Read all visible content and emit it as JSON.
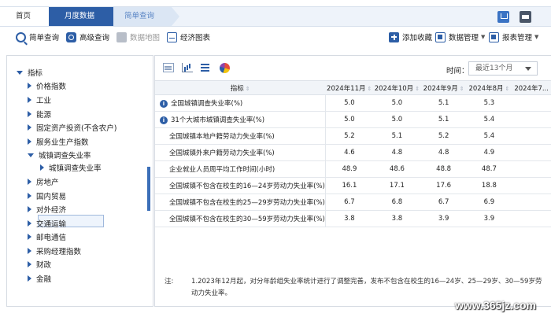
{
  "breadcrumb": {
    "home": "首页",
    "current": "月度数据",
    "next": "简单查询"
  },
  "toolbar": {
    "simple_query": "简单查询",
    "advanced_query": "高级查询",
    "data_map": "数据地图",
    "econ_chart": "经济图表",
    "add_favorite": "添加收藏",
    "data_manage": "数据管理",
    "report_manage": "报表管理"
  },
  "tree": {
    "root": "指标",
    "items": [
      "价格指数",
      "工业",
      "能源",
      "固定资产投资(不含农户)",
      "服务业生产指数",
      "城镇调查失业率",
      "城镇调查失业率",
      "房地产",
      "国内贸易",
      "对外经济",
      "交通运输",
      "邮电通信",
      "采购经理指数",
      "财政",
      "金融"
    ]
  },
  "controls": {
    "time_label": "时间：",
    "time_value": "最近13个月"
  },
  "table": {
    "header_indicator": "指标",
    "columns": [
      "2024年11月",
      "2024年10月",
      "2024年9月",
      "2024年8月",
      "2024年7..."
    ],
    "rows": [
      {
        "name": "全国城镇调查失业率(%)",
        "info": true,
        "values": [
          "5.0",
          "5.0",
          "5.1",
          "5.3"
        ]
      },
      {
        "name": "31个大城市城镇调查失业率(%)",
        "info": true,
        "values": [
          "5.0",
          "5.0",
          "5.1",
          "5.4"
        ]
      },
      {
        "name": "全国城镇本地户籍劳动力失业率(%)",
        "info": false,
        "values": [
          "5.2",
          "5.1",
          "5.2",
          "5.4"
        ]
      },
      {
        "name": "全国城镇外来户籍劳动力失业率(%)",
        "info": false,
        "values": [
          "4.6",
          "4.8",
          "4.8",
          "4.9"
        ]
      },
      {
        "name": "企业就业人员周平均工作时间(小时)",
        "info": false,
        "values": [
          "48.9",
          "48.6",
          "48.8",
          "48.7"
        ]
      },
      {
        "name": "全国城镇不包含在校生的16—24岁劳动力失业率(%)",
        "info": false,
        "values": [
          "16.1",
          "17.1",
          "17.6",
          "18.8"
        ]
      },
      {
        "name": "全国城镇不包含在校生的25—29岁劳动力失业率(%)",
        "info": false,
        "values": [
          "6.7",
          "6.8",
          "6.7",
          "6.9"
        ]
      },
      {
        "name": "全国城镇不包含在校生的30—59岁劳动力失业率(%)",
        "info": false,
        "values": [
          "3.8",
          "3.8",
          "3.9",
          "3.9"
        ]
      }
    ]
  },
  "note": {
    "label": "注:",
    "text": "1.2023年12月起，对分年龄组失业率统计进行了调整完善，发布不包含在校生的16—24岁、25—29岁、30—59岁劳动力失业率。"
  },
  "watermark": "www.365jz.com",
  "colors": {
    "accent": "#2d5ea6",
    "breadcrumb_bg": "#eef3fa"
  }
}
